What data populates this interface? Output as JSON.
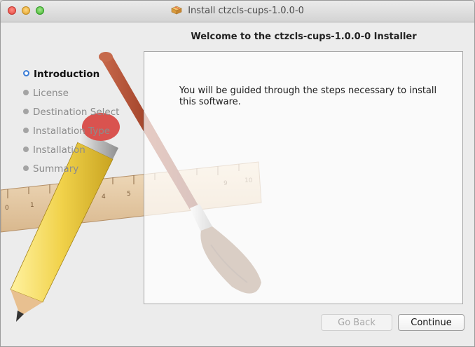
{
  "window": {
    "title": "Install ctzcls-cups-1.0.0-0",
    "title_icon": "package-icon"
  },
  "header": {
    "title": "Welcome to the ctzcls-cups-1.0.0-0 Installer"
  },
  "sidebar": {
    "current_step": "Introduction",
    "steps": [
      {
        "label": "Introduction"
      },
      {
        "label": "License"
      },
      {
        "label": "Destination Select"
      },
      {
        "label": "Installation Type"
      },
      {
        "label": "Installation"
      },
      {
        "label": "Summary"
      }
    ]
  },
  "content": {
    "intro_text": "You will be guided through the steps necessary to install this software."
  },
  "buttons": {
    "back_label": "Go Back",
    "continue_label": "Continue"
  },
  "background_art": {
    "ruler_numbers": [
      "0",
      "1",
      "4",
      "5",
      "9",
      "10"
    ]
  },
  "colors": {
    "current_step_accent": "#3a7cd6"
  }
}
